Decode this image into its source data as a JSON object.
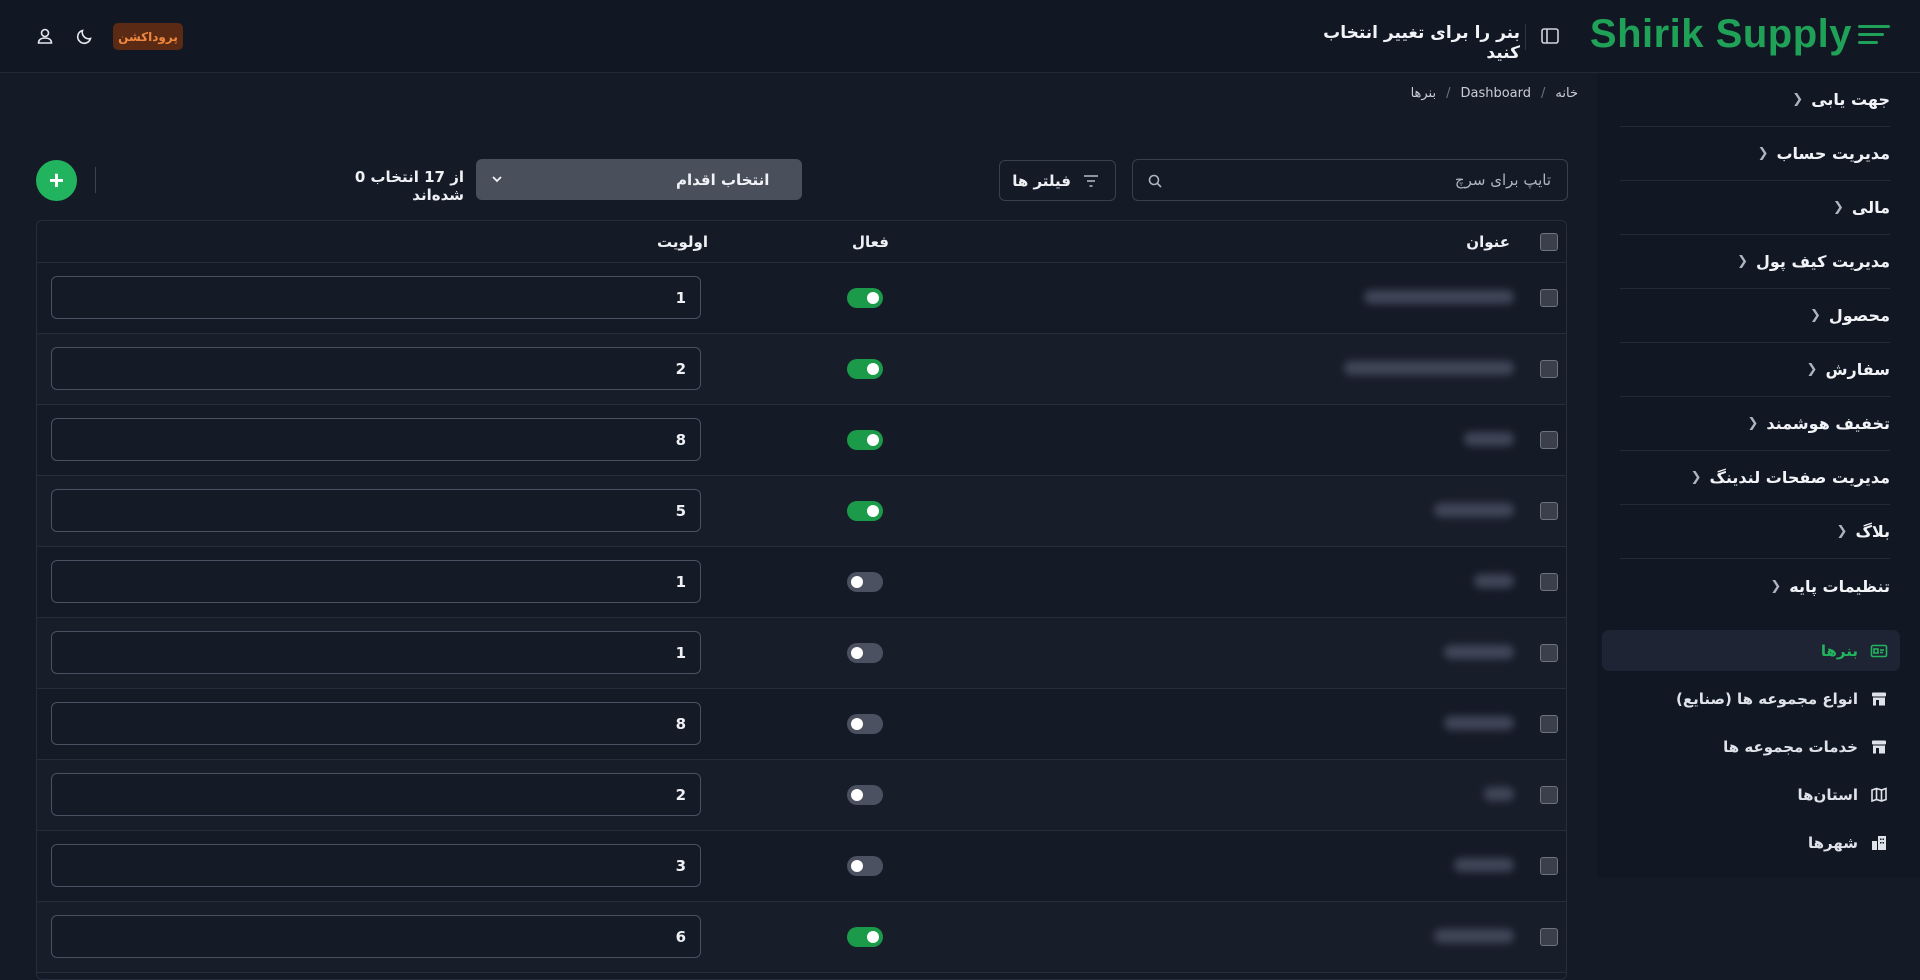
{
  "app": {
    "logo_text": "Shirik Supply",
    "brand_color": "#1fa257"
  },
  "header": {
    "title": "بنر را برای تغییر انتخاب کنید",
    "environment_badge": "پروداکشن",
    "icons": {
      "sidebar_toggle": "sidebar-toggle-icon",
      "theme": "moon-icon",
      "user": "user-icon"
    }
  },
  "breadcrumb": [
    "خانه",
    "Dashboard",
    "بنرها"
  ],
  "sidebar": {
    "groups": [
      {
        "label": "جهت یابی"
      },
      {
        "label": "مدیریت حساب"
      },
      {
        "label": "مالی"
      },
      {
        "label": "مدیریت کیف پول"
      },
      {
        "label": "محصول"
      },
      {
        "label": "سفارش"
      },
      {
        "label": "تخفیف هوشمند"
      },
      {
        "label": "مدیریت صفحات لندینگ"
      },
      {
        "label": "بلاگ"
      },
      {
        "label": "تنظیمات پایه"
      }
    ],
    "sub_items": [
      {
        "label": "بنرها",
        "icon": "banner-icon",
        "active": true
      },
      {
        "label": "انواع مجموعه ها (صنایع)",
        "icon": "store-icon",
        "active": false
      },
      {
        "label": "خدمات مجموعه ها",
        "icon": "store-icon",
        "active": false
      },
      {
        "label": "استان‌ها",
        "icon": "map-icon",
        "active": false
      },
      {
        "label": "شهرها",
        "icon": "buildings-icon",
        "active": false
      }
    ]
  },
  "toolbar": {
    "selected_count": "0 از 17 انتخاب شده‌اند",
    "action_select_label": "انتخاب اقدام",
    "filter_label": "فیلتر ها",
    "search_placeholder": "تایپ برای سرچ",
    "add_button": "+"
  },
  "table": {
    "columns": [
      "عنوان",
      "فعال",
      "اولویت"
    ],
    "rows": [
      {
        "active": true,
        "priority": "1"
      },
      {
        "active": true,
        "priority": "2"
      },
      {
        "active": true,
        "priority": "8"
      },
      {
        "active": true,
        "priority": "5"
      },
      {
        "active": false,
        "priority": "1"
      },
      {
        "active": false,
        "priority": "1"
      },
      {
        "active": false,
        "priority": "8"
      },
      {
        "active": false,
        "priority": "2"
      },
      {
        "active": false,
        "priority": "3"
      },
      {
        "active": true,
        "priority": "6"
      }
    ]
  }
}
